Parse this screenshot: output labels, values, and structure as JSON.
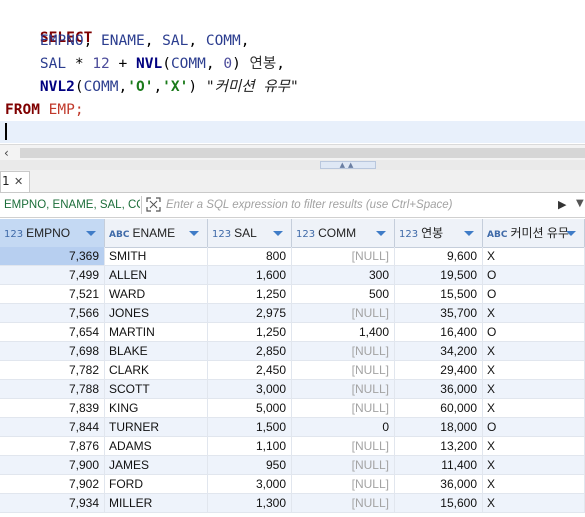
{
  "editor": {
    "kw_select": "SELECT",
    "line2": {
      "empno": "EMPNO",
      "ename": "ENAME",
      "sal": "SAL",
      "comm": "COMM",
      "comma": ", ",
      "trail": ","
    },
    "line3": {
      "sal": "SAL",
      "times": " * ",
      "twelve": "12",
      "plus": " + ",
      "nvl": "NVL",
      "open": "(",
      "comm": "COMM",
      "sep": ", ",
      "zero": "0",
      "close": ")",
      "alias": " 연봉",
      "trail": ","
    },
    "line4": {
      "nvl2": "NVL2",
      "open": "(",
      "comm": "COMM",
      "sep1": ",",
      "o": "'O'",
      "sep2": ",",
      "x": "'X'",
      "close": ")",
      "alias": "\"커미션 유무\""
    },
    "line5": {
      "from": "FROM",
      "emp": " EMP;"
    }
  },
  "tab": {
    "index": "1",
    "close": "✕"
  },
  "filter": {
    "columns_text": "EMPNO, ENAME, SAL, CO",
    "placeholder": "Enter a SQL expression to filter results (use Ctrl+Space)"
  },
  "grid": {
    "columns": [
      {
        "type": "123",
        "name": "EMPNO"
      },
      {
        "type": "ABC",
        "name": "ENAME"
      },
      {
        "type": "123",
        "name": "SAL"
      },
      {
        "type": "123",
        "name": "COMM"
      },
      {
        "type": "123",
        "name": "연봉"
      },
      {
        "type": "ABC",
        "name": "커미션 유무"
      }
    ],
    "rows": [
      [
        "7,369",
        "SMITH",
        "800",
        "[NULL]",
        "9,600",
        "X"
      ],
      [
        "7,499",
        "ALLEN",
        "1,600",
        "300",
        "19,500",
        "O"
      ],
      [
        "7,521",
        "WARD",
        "1,250",
        "500",
        "15,500",
        "O"
      ],
      [
        "7,566",
        "JONES",
        "2,975",
        "[NULL]",
        "35,700",
        "X"
      ],
      [
        "7,654",
        "MARTIN",
        "1,250",
        "1,400",
        "16,400",
        "O"
      ],
      [
        "7,698",
        "BLAKE",
        "2,850",
        "[NULL]",
        "34,200",
        "X"
      ],
      [
        "7,782",
        "CLARK",
        "2,450",
        "[NULL]",
        "29,400",
        "X"
      ],
      [
        "7,788",
        "SCOTT",
        "3,000",
        "[NULL]",
        "36,000",
        "X"
      ],
      [
        "7,839",
        "KING",
        "5,000",
        "[NULL]",
        "60,000",
        "X"
      ],
      [
        "7,844",
        "TURNER",
        "1,500",
        "0",
        "18,000",
        "O"
      ],
      [
        "7,876",
        "ADAMS",
        "1,100",
        "[NULL]",
        "13,200",
        "X"
      ],
      [
        "7,900",
        "JAMES",
        "950",
        "[NULL]",
        "11,400",
        "X"
      ],
      [
        "7,902",
        "FORD",
        "3,000",
        "[NULL]",
        "36,000",
        "X"
      ],
      [
        "7,934",
        "MILLER",
        "1,300",
        "[NULL]",
        "15,600",
        "X"
      ]
    ]
  },
  "colors": {
    "keyword": "#7f0000",
    "function": "#00007f",
    "string": "#1a7a1a",
    "null_text": "#a3a3a3",
    "selection": "#b7cff0"
  }
}
